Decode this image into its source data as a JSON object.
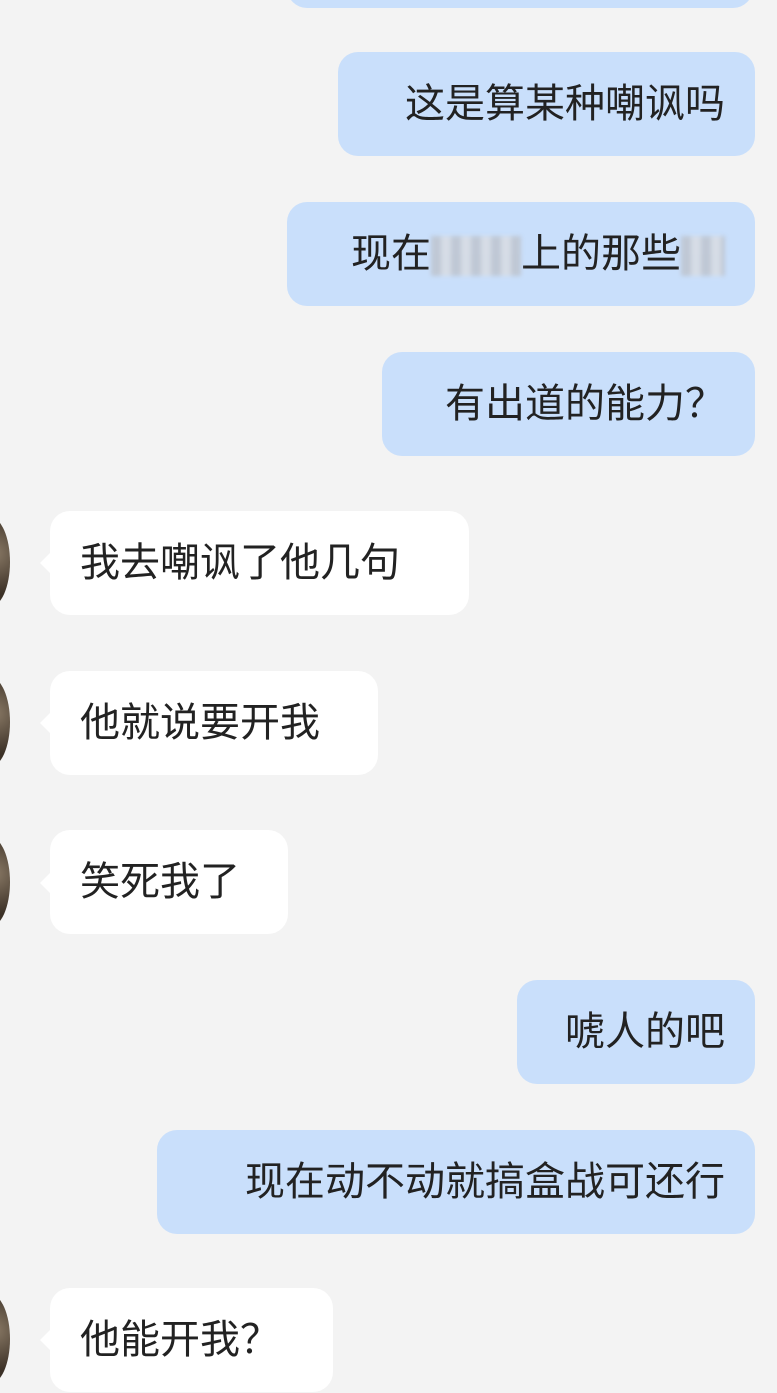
{
  "messages": [
    {
      "side": "sent",
      "text": "这是算某种嘲讽吗"
    },
    {
      "side": "sent",
      "text_before": "现在",
      "text_middle": "上的那些"
    },
    {
      "side": "sent",
      "text": "有出道的能力？"
    },
    {
      "side": "recv",
      "text": "我去嘲讽了他几句"
    },
    {
      "side": "recv",
      "text": "他就说要开我"
    },
    {
      "side": "recv",
      "text": "笑死我了"
    },
    {
      "side": "sent",
      "text": "唬人的吧"
    },
    {
      "side": "sent",
      "text": "现在动不动就搞盒战可还行"
    },
    {
      "side": "recv",
      "text": "他能开我？"
    }
  ],
  "colors": {
    "background": "#f3f3f3",
    "sent_bubble": "#c9dffb",
    "recv_bubble": "#ffffff",
    "text": "#222222"
  }
}
